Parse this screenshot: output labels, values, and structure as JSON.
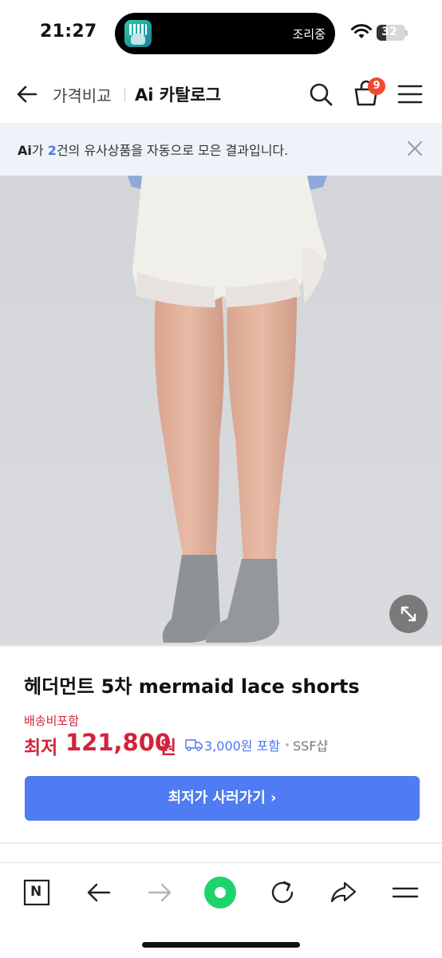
{
  "status_bar": {
    "time": "21:27",
    "island_label": "조리중",
    "battery": "32",
    "battery_level": 0.32
  },
  "header": {
    "price_compare": "가격비교",
    "title": "Ai 카탈로그",
    "cart_count": "9"
  },
  "notice": {
    "ai": "Ai",
    "part1": "가 ",
    "count": "2",
    "part2": "건의 유사상품을 자동으로 모은 결과입니다."
  },
  "product": {
    "title": "헤더먼트 5차 mermaid lace shorts",
    "shipping_label": "배송비포함",
    "price_prefix": "최저",
    "price": "121,800",
    "price_unit": "원",
    "delivery": "3,000원 포함",
    "seller": "SSF샵",
    "buy_button": "최저가 사러가기 ›"
  },
  "toolbar": {
    "home_letter": "N"
  },
  "colors": {
    "price_red": "#d2233a",
    "accent_blue": "#4f7cf2",
    "banner_bg": "#eef3fa",
    "badge_red": "#f0492f",
    "green_button": "#1ed36b"
  }
}
